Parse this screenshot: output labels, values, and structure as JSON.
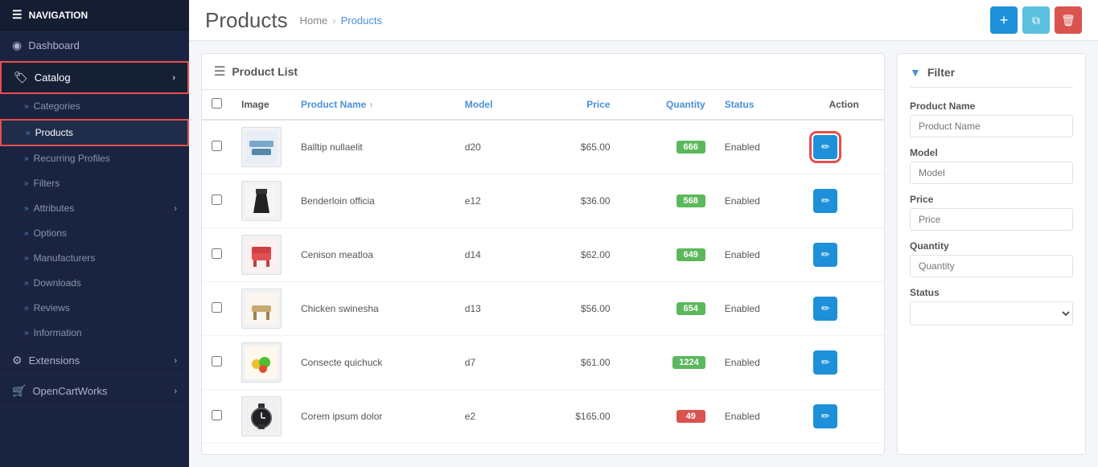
{
  "sidebar": {
    "nav_label": "NAVIGATION",
    "items": [
      {
        "id": "dashboard",
        "label": "Dashboard",
        "icon": "🏠",
        "active": false,
        "level": 0
      },
      {
        "id": "catalog",
        "label": "Catalog",
        "icon": "🏷",
        "active": true,
        "level": 0,
        "hasChevron": true
      },
      {
        "id": "categories",
        "label": "Categories",
        "active": false,
        "level": 1
      },
      {
        "id": "products",
        "label": "Products",
        "active": true,
        "level": 1
      },
      {
        "id": "recurring-profiles",
        "label": "Recurring Profiles",
        "active": false,
        "level": 1
      },
      {
        "id": "filters",
        "label": "Filters",
        "active": false,
        "level": 1
      },
      {
        "id": "attributes",
        "label": "Attributes",
        "active": false,
        "level": 1,
        "hasChevron": true
      },
      {
        "id": "options",
        "label": "Options",
        "active": false,
        "level": 1
      },
      {
        "id": "manufacturers",
        "label": "Manufacturers",
        "active": false,
        "level": 1
      },
      {
        "id": "downloads",
        "label": "Downloads",
        "active": false,
        "level": 1
      },
      {
        "id": "reviews",
        "label": "Reviews",
        "active": false,
        "level": 1
      },
      {
        "id": "information",
        "label": "Information",
        "active": false,
        "level": 1
      },
      {
        "id": "extensions",
        "label": "Extensions",
        "icon": "⚙",
        "active": false,
        "level": 0,
        "hasChevron": true
      },
      {
        "id": "opencartworks",
        "label": "OpenCartWorks",
        "icon": "🛒",
        "active": false,
        "level": 0,
        "hasChevron": true
      }
    ]
  },
  "breadcrumb": {
    "home": "Home",
    "separator": "›",
    "current": "Products"
  },
  "page": {
    "title": "Products",
    "panel_title": "Product List"
  },
  "buttons": {
    "add": "+",
    "copy": "⧉",
    "delete": "🗑"
  },
  "table": {
    "columns": [
      "",
      "Image",
      "Product Name",
      "Model",
      "Price",
      "Quantity",
      "Status",
      "Action"
    ],
    "sort_indicator": "↑",
    "rows": [
      {
        "id": 1,
        "name": "Balltip nullaelit",
        "model": "d20",
        "price": "$65.00",
        "qty": "666",
        "qty_low": false,
        "status": "Enabled",
        "highlighted": true
      },
      {
        "id": 2,
        "name": "Benderloin officia",
        "model": "e12",
        "price": "$36.00",
        "qty": "568",
        "qty_low": false,
        "status": "Enabled",
        "highlighted": false
      },
      {
        "id": 3,
        "name": "Cenison meatloa",
        "model": "d14",
        "price": "$62.00",
        "qty": "649",
        "qty_low": false,
        "status": "Enabled",
        "highlighted": false
      },
      {
        "id": 4,
        "name": "Chicken swinesha",
        "model": "d13",
        "price": "$56.00",
        "qty": "654",
        "qty_low": false,
        "status": "Enabled",
        "highlighted": false
      },
      {
        "id": 5,
        "name": "Consecte quichuck",
        "model": "d7",
        "price": "$61.00",
        "qty": "1224",
        "qty_low": false,
        "status": "Enabled",
        "highlighted": false
      },
      {
        "id": 6,
        "name": "Corem ipsum dolor",
        "model": "e2",
        "price": "$165.00",
        "qty": "49",
        "qty_low": true,
        "status": "Enabled",
        "highlighted": false
      }
    ]
  },
  "filter": {
    "title": "Filter",
    "fields": [
      {
        "id": "product-name",
        "label": "Product Name",
        "placeholder": "Product Name",
        "type": "text"
      },
      {
        "id": "model",
        "label": "Model",
        "placeholder": "Model",
        "type": "text"
      },
      {
        "id": "price",
        "label": "Price",
        "placeholder": "Price",
        "type": "text"
      },
      {
        "id": "quantity",
        "label": "Quantity",
        "placeholder": "Quantity",
        "type": "text"
      },
      {
        "id": "status",
        "label": "Status",
        "placeholder": "",
        "type": "select"
      }
    ]
  }
}
